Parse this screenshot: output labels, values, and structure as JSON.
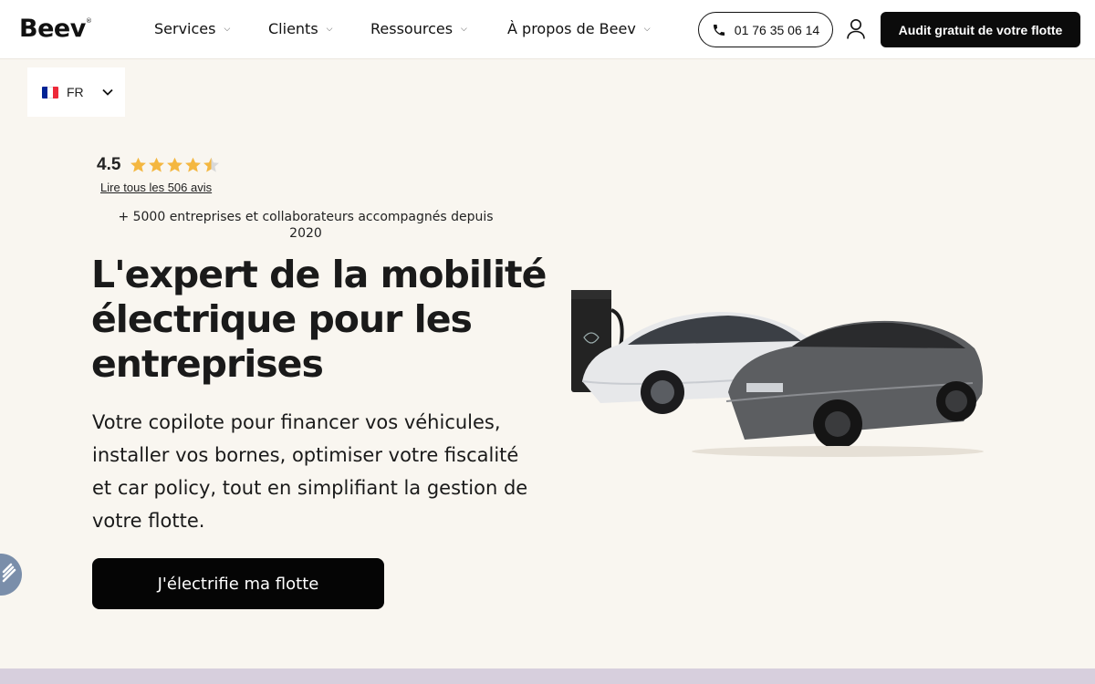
{
  "header": {
    "logo": "Beev",
    "logo_mark": "®",
    "nav": [
      {
        "label": "Services"
      },
      {
        "label": "Clients"
      },
      {
        "label": "Ressources"
      },
      {
        "label": "À propos de Beev"
      }
    ],
    "phone": "01 76 35 06 14",
    "cta": "Audit gratuit de votre flotte"
  },
  "language": {
    "code": "FR",
    "flag_colors": [
      "#002395",
      "#ffffff",
      "#ed2939"
    ]
  },
  "rating": {
    "score": "4.5",
    "stars": 4.5,
    "star_color": "#f4b740",
    "reviews_link": "Lire tous les 506 avis"
  },
  "hero": {
    "subtitle": "+ 5000 entreprises et collaborateurs accompagnés depuis 2020",
    "headline": "L'expert de la mobilité électrique pour les entreprises",
    "description": "Votre copilote pour financer vos véhicules, installer vos bornes, optimiser votre fiscalité et car policy, tout en simplifiant la gestion de votre flotte.",
    "cta": "J'électrifie ma flotte"
  },
  "colors": {
    "background": "#f9f6f0",
    "primary": "#0b0b0b",
    "widget": "#7a8eaa",
    "bottom_strip": "#d7cfdd"
  },
  "icons": [
    "chevron-down-icon",
    "phone-icon",
    "user-icon",
    "star-icon",
    "half-star-icon",
    "accessibility-icon"
  ]
}
